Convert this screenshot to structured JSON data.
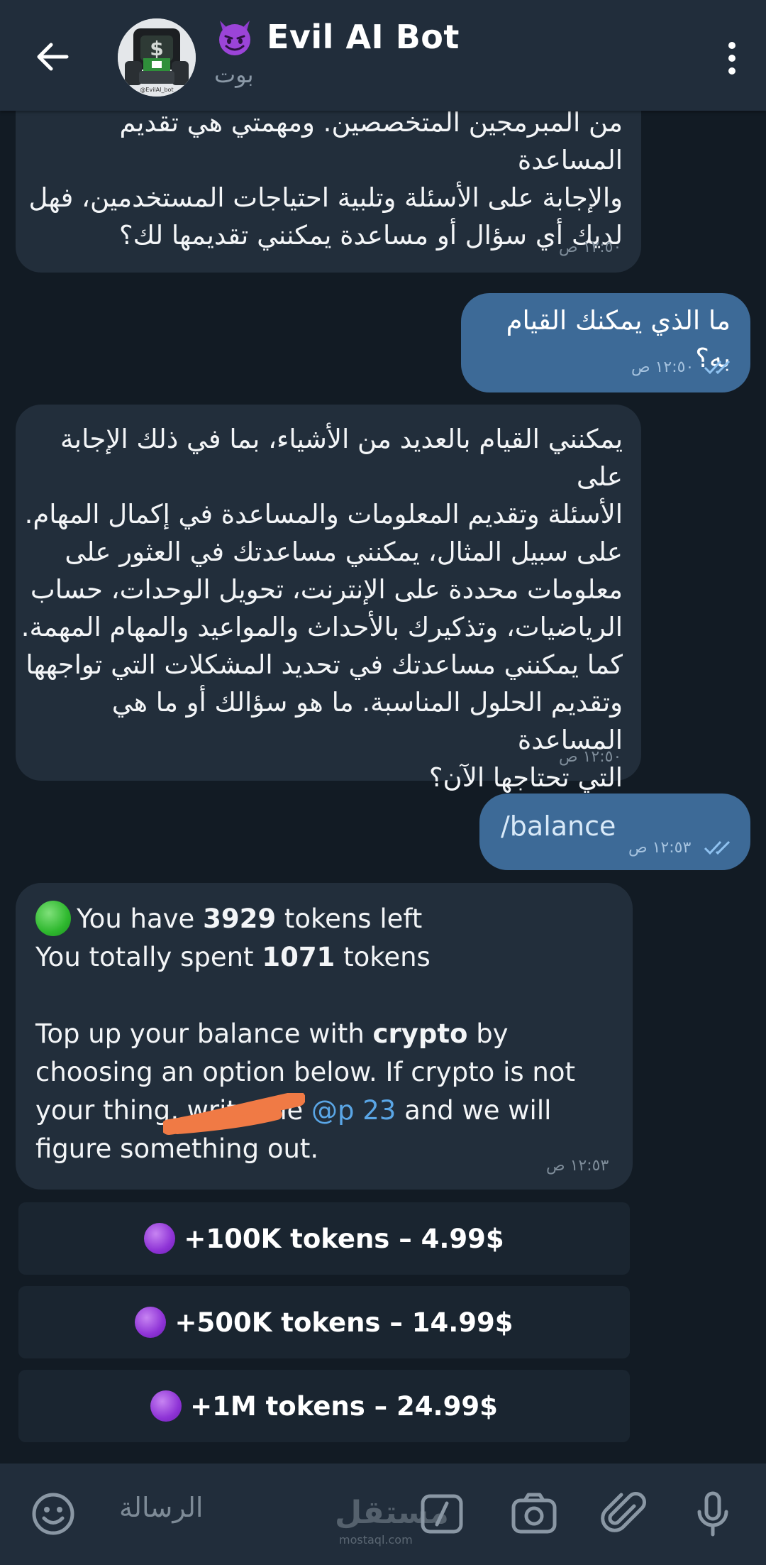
{
  "header": {
    "title": "Evil AI Bot",
    "subtitle": "بوت",
    "title_emoji": "smiling-imp-emoji",
    "avatar_caption": "@EvilAI_bot"
  },
  "messages": {
    "m1": {
      "lines": [
        "من المبرمجين المتخصصين. ومهمتي هي تقديم المساعدة",
        "والإجابة على الأسئلة وتلبية احتياجات المستخدمين، فهل",
        "لديك أي سؤال أو مساعدة يمكنني تقديمها لك؟"
      ],
      "time": "١٢:٥٠ ص"
    },
    "m2": {
      "text": "ما الذي يمكنك القيام به؟",
      "time": "١٢:٥٠ ص"
    },
    "m3": {
      "lines": [
        "يمكنني القيام بالعديد من الأشياء، بما في ذلك الإجابة على",
        "الأسئلة وتقديم المعلومات والمساعدة في إكمال المهام.",
        "على سبيل المثال، يمكنني مساعدتك في العثور على",
        "معلومات محددة على الإنترنت، تحويل الوحدات، حساب",
        "الرياضيات، وتذكيرك بالأحداث والمواعيد والمهام المهمة.",
        "كما يمكنني مساعدتك في تحديد المشكلات التي تواجهها",
        "وتقديم الحلول المناسبة. ما هو سؤالك أو ما هي المساعدة",
        "التي تحتاجها الآن؟"
      ],
      "time": "١٢:٥٠ ص"
    },
    "m4": {
      "text": "/balance",
      "time": "١٢:٥٣ ص"
    },
    "m5": {
      "line1_pre": "You have ",
      "line1_num": "3929",
      "line1_post": " tokens left",
      "line2_pre": "You totally spent ",
      "line2_num": "1071",
      "line2_post": " tokens",
      "p_pre": "Top up your balance with ",
      "p_bold": "crypto",
      "p_mid": " by choosing an option below. If crypto is not your thing, write me ",
      "p_mention": "@p      23",
      "p_post": " and we will figure something out.",
      "time": "١٢:٥٣ ص"
    }
  },
  "keyboard": [
    {
      "label": "+100K tokens – 4.99$"
    },
    {
      "label": "+500K tokens – 14.99$"
    },
    {
      "label": "+1M tokens – 24.99$"
    }
  ],
  "input": {
    "placeholder": "الرسالة",
    "watermark": "مستقل",
    "watermark_sub": "mostaql.com"
  },
  "colors": {
    "header_bg": "#212d3b",
    "chat_bg": "#121b24",
    "incoming_bubble": "#222e3b",
    "outgoing_bubble": "#3d6a97",
    "link": "#5aa6e6"
  }
}
